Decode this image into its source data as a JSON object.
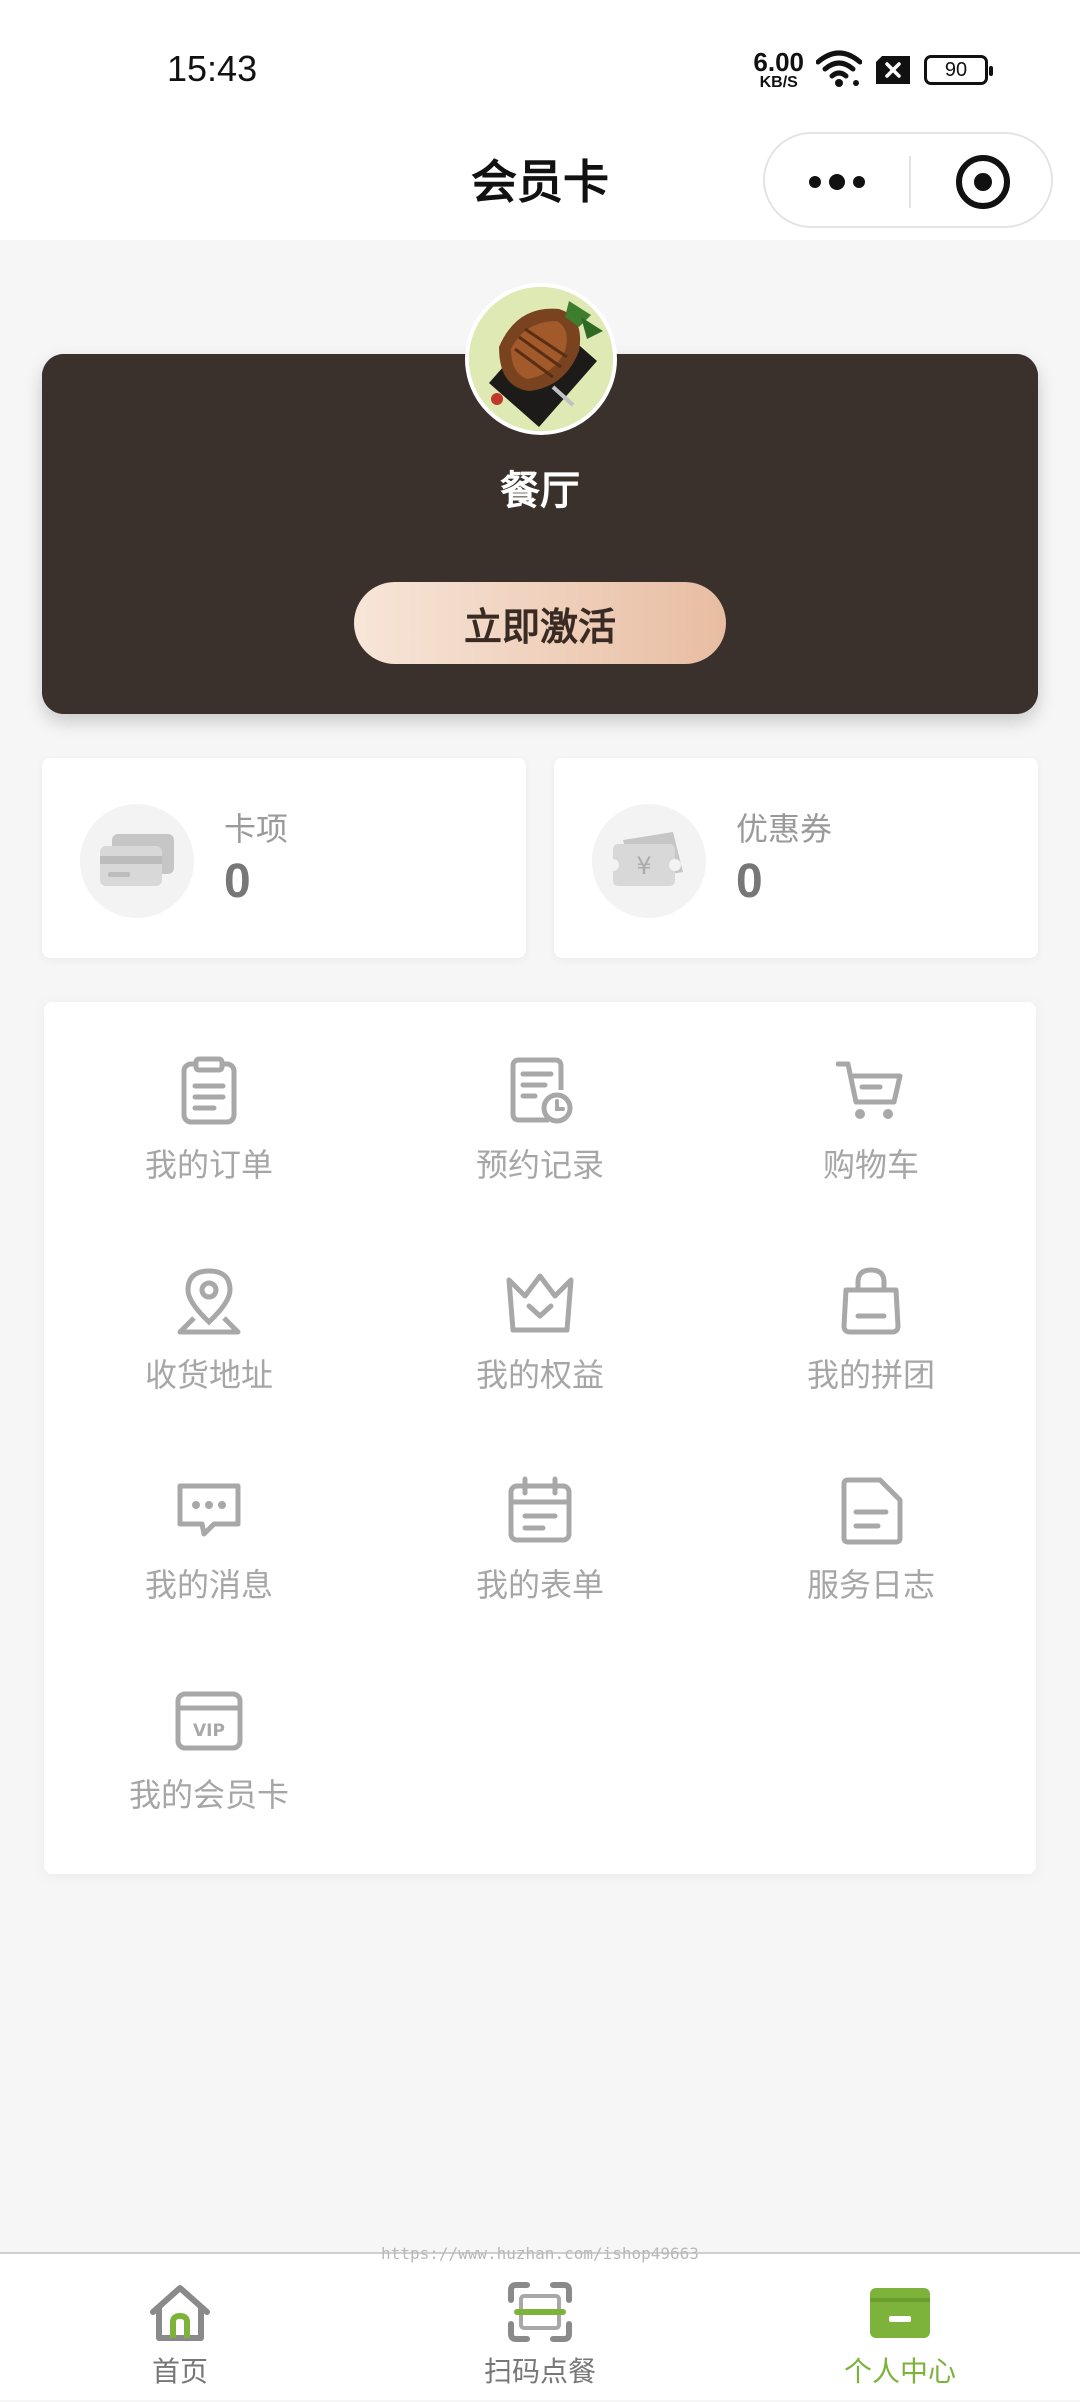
{
  "status_bar": {
    "time": "15:43",
    "net_speed_value": "6.00",
    "net_speed_unit": "KB/S",
    "battery": "90"
  },
  "nav": {
    "title": "会员卡"
  },
  "card": {
    "store_name": "餐厅",
    "activate_label": "立即激活"
  },
  "stats": [
    {
      "label": "卡项",
      "value": "0"
    },
    {
      "label": "优惠券",
      "value": "0"
    }
  ],
  "menu": [
    {
      "label": "我的订单",
      "icon": "clipboard-icon"
    },
    {
      "label": "预约记录",
      "icon": "appointment-record-icon"
    },
    {
      "label": "购物车",
      "icon": "cart-icon"
    },
    {
      "label": "收货地址",
      "icon": "location-pin-icon"
    },
    {
      "label": "我的权益",
      "icon": "crown-icon"
    },
    {
      "label": "我的拼团",
      "icon": "shopping-bag-icon"
    },
    {
      "label": "我的消息",
      "icon": "message-icon"
    },
    {
      "label": "我的表单",
      "icon": "calendar-form-icon"
    },
    {
      "label": "服务日志",
      "icon": "document-icon"
    },
    {
      "label": "我的会员卡",
      "icon": "vip-card-icon"
    }
  ],
  "watermark": "https://www.huzhan.com/ishop49663",
  "tabs": [
    {
      "label": "首页",
      "icon": "home-icon",
      "active": false
    },
    {
      "label": "扫码点餐",
      "icon": "scan-icon",
      "active": false
    },
    {
      "label": "个人中心",
      "icon": "profile-card-icon",
      "active": true
    }
  ],
  "colors": {
    "accent": "#7db33a",
    "card_bg": "#2a2220",
    "button_gradient_start": "#f7e6d9",
    "button_gradient_end": "#e8bda2"
  }
}
